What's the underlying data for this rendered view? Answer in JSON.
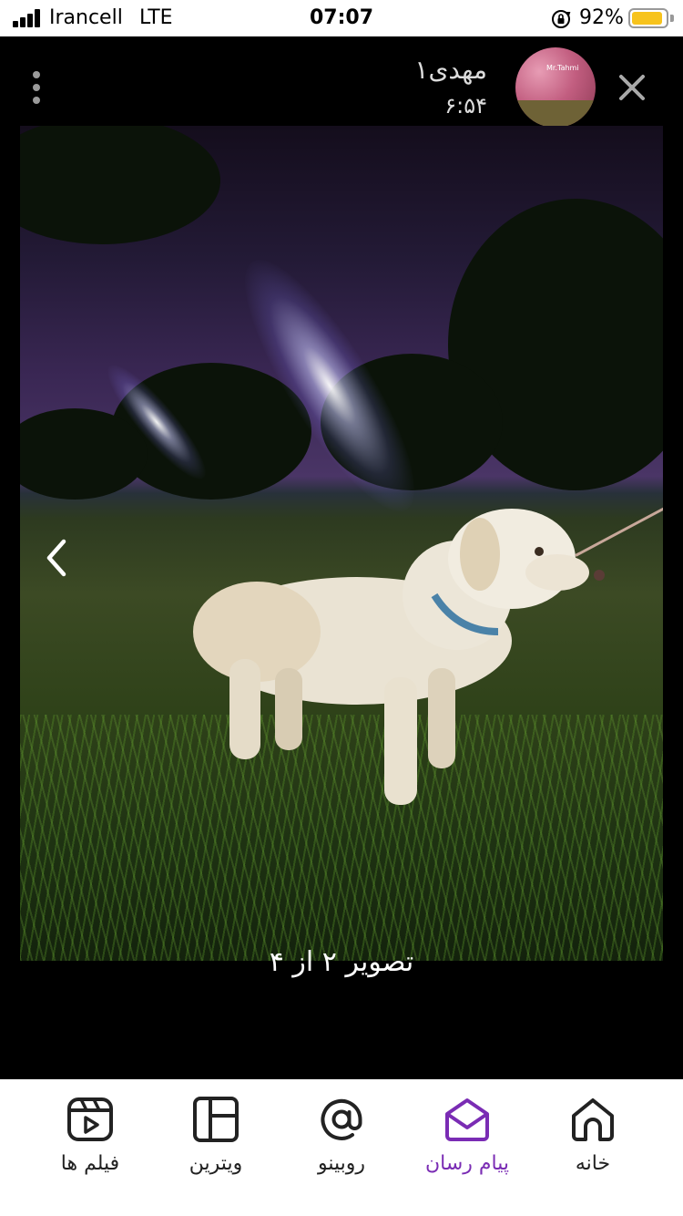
{
  "status_bar": {
    "carrier": "Irancell",
    "network": "LTE",
    "time": "07:07",
    "battery_percent": "92%",
    "battery_level": 0.92,
    "battery_color": "#f7c31c"
  },
  "viewer": {
    "sender_name": "مهدی۱",
    "sender_time": "۶:۵۴",
    "avatar_badge": "Mr.Tahmi",
    "caption": "تصویر ۲ از ۴",
    "icons": [
      "more-vertical-icon",
      "close-icon",
      "chevron-left-icon"
    ]
  },
  "bottom_nav": {
    "accent": "#7a2cb4",
    "items": [
      {
        "label": "فیلم ها",
        "icon": "video-icon"
      },
      {
        "label": "ویترین",
        "icon": "layout-icon"
      },
      {
        "label": "روبینو",
        "icon": "at-icon"
      },
      {
        "label": "پیام رسان",
        "icon": "messenger-icon",
        "active": true
      },
      {
        "label": "خانه",
        "icon": "home-icon"
      }
    ]
  }
}
